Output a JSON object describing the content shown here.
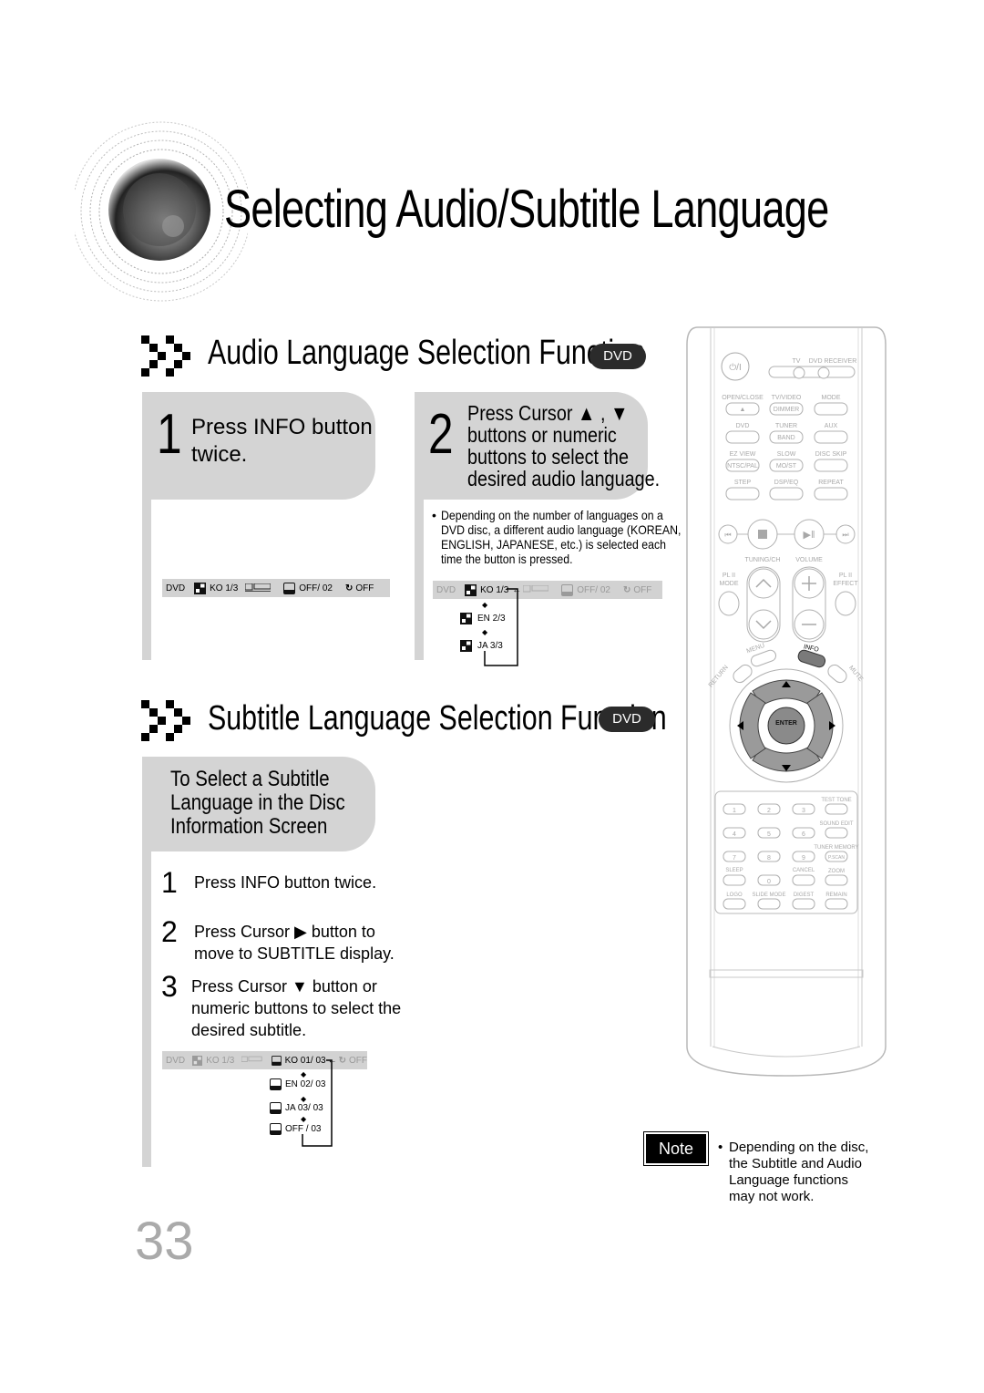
{
  "header": {
    "title": "Selecting Audio/Subtitle Language"
  },
  "audio_section": {
    "title": "Audio Language Selection Function",
    "badge": "DVD",
    "step1": {
      "number": "1",
      "lines": [
        "Press INFO button",
        "twice."
      ]
    },
    "step2": {
      "number": "2",
      "lines": [
        "Press Cursor ▲ , ▼",
        "buttons or numeric",
        "buttons to select the",
        "desired audio language."
      ]
    },
    "bullet": {
      "symbol": "•",
      "lines": [
        "Depending on the number of languages on a",
        "DVD disc, a different audio language (KOREAN,",
        "ENGLISH, JAPANESE, etc.) is selected each",
        "time the button is pressed."
      ]
    },
    "osd_step1": {
      "source": "DVD",
      "audio": "KO 1/3",
      "subtitle": "OFF/  02",
      "repeat": "OFF"
    },
    "osd_step2": {
      "source": "DVD",
      "audio": "KO 1/3",
      "subtitle": "OFF/  02",
      "repeat": "OFF",
      "options": [
        "EN 2/3",
        "JA 3/3"
      ]
    }
  },
  "subtitle_section": {
    "title": "Subtitle Language Selection Function",
    "badge": "DVD",
    "panel_lines": [
      "To Select a Subtitle",
      "Language in the Disc",
      "Information Screen"
    ],
    "steps": [
      {
        "number": "1",
        "lines": [
          "Press INFO button twice."
        ]
      },
      {
        "number": "2",
        "lines": [
          "Press Cursor ▶ button to",
          "move to SUBTITLE display."
        ]
      },
      {
        "number": "3",
        "lines": [
          "Press Cursor ▼  button or",
          "numeric buttons to select the",
          "desired subtitle."
        ]
      }
    ],
    "osd": {
      "source": "DVD",
      "audio": "KO 1/3",
      "subtitle": "KO 01/ 03",
      "repeat": "OFF",
      "options": [
        "EN 02/ 03",
        "JA 03/ 03",
        "OFF / 03"
      ]
    }
  },
  "note": {
    "label": "Note",
    "symbol": "•",
    "lines": [
      "Depending on the disc,",
      "the Subtitle and Audio",
      "Language functions",
      "may not work."
    ]
  },
  "page_number": "33",
  "remote": {
    "power": "⏻/I",
    "mode_labels": [
      "TV",
      "DVD RECEIVER"
    ],
    "rows": [
      [
        "OPEN/CLOSE",
        "TV/VIDEO",
        "MODE"
      ],
      [
        "DVD",
        "TUNER",
        "AUX"
      ],
      [
        "EZ VIEW",
        "SLOW",
        "DISC SKIP"
      ],
      [
        "STEP",
        "DSP/EQ",
        "REPEAT"
      ]
    ],
    "button_sublabels": [
      "▲",
      "DIMMER",
      "",
      "",
      "BAND",
      "",
      "NTSC/PAL",
      "MO/ST",
      "",
      "",
      "",
      ""
    ],
    "tuning_label": "TUNING/CH",
    "volume_label": "VOLUME",
    "pl_mode": [
      "PL II",
      "MODE"
    ],
    "pl_effect": [
      "PL II",
      "EFFECT"
    ],
    "menu": "MENU",
    "info": "INFO",
    "return": "RETURN",
    "mute": "MUTE",
    "enter": "ENTER",
    "keypad": [
      "1",
      "2",
      "3",
      "4",
      "5",
      "6",
      "7",
      "8",
      "9",
      "0"
    ],
    "side_labels": [
      "TEST TONE",
      "SOUND EDIT",
      "TUNER MEMORY",
      "P.SCAN",
      "ZOOM",
      "REMAIN"
    ],
    "bottom_labels": [
      "SLEEP",
      "CANCEL",
      "LOGO",
      "SLIDE MODE",
      "DIGEST"
    ]
  }
}
